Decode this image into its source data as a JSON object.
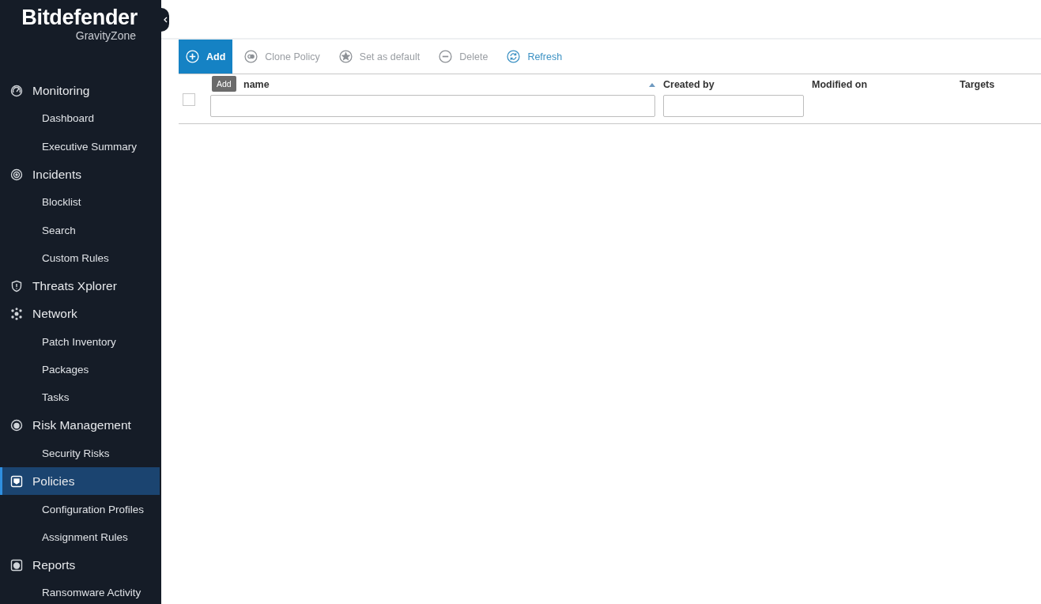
{
  "brand": {
    "name": "Bitdefender",
    "product": "GravityZone"
  },
  "nav": [
    {
      "kind": "section",
      "label": "Monitoring",
      "selected": false
    },
    {
      "kind": "sub",
      "label": "Dashboard",
      "selected": false
    },
    {
      "kind": "sub",
      "label": "Executive Summary",
      "selected": false
    },
    {
      "kind": "section",
      "label": "Incidents",
      "selected": false
    },
    {
      "kind": "sub",
      "label": "Blocklist",
      "selected": false
    },
    {
      "kind": "sub",
      "label": "Search",
      "selected": false
    },
    {
      "kind": "sub",
      "label": "Custom Rules",
      "selected": false
    },
    {
      "kind": "section",
      "label": "Threats Xplorer",
      "selected": false
    },
    {
      "kind": "section",
      "label": "Network",
      "selected": false
    },
    {
      "kind": "sub",
      "label": "Patch Inventory",
      "selected": false
    },
    {
      "kind": "sub",
      "label": "Packages",
      "selected": false
    },
    {
      "kind": "sub",
      "label": "Tasks",
      "selected": false
    },
    {
      "kind": "section",
      "label": "Risk Management",
      "selected": false
    },
    {
      "kind": "sub",
      "label": "Security Risks",
      "selected": false
    },
    {
      "kind": "section",
      "label": "Policies",
      "selected": true
    },
    {
      "kind": "sub",
      "label": "Configuration Profiles",
      "selected": false
    },
    {
      "kind": "sub",
      "label": "Assignment Rules",
      "selected": false
    },
    {
      "kind": "section",
      "label": "Reports",
      "selected": false
    },
    {
      "kind": "sub",
      "label": "Ransomware Activity",
      "selected": false
    }
  ],
  "toolbar": [
    {
      "label": "Add",
      "selected": true,
      "disabled": false
    },
    {
      "label": "Clone Policy",
      "selected": false,
      "disabled": true
    },
    {
      "label": "Set as default",
      "selected": false,
      "disabled": true
    },
    {
      "label": "Delete",
      "selected": false,
      "disabled": true
    },
    {
      "label": "Refresh",
      "selected": false,
      "disabled": false
    }
  ],
  "tooltip": "Add",
  "table": {
    "select_all": {
      "checked": false
    },
    "columns": [
      {
        "label": "name",
        "sorted": true,
        "filter": true
      },
      {
        "label": "Created by",
        "sorted": false,
        "filter": true
      },
      {
        "label": "Modified on",
        "sorted": false,
        "filter": false
      },
      {
        "label": "Targets",
        "sorted": false,
        "filter": false
      }
    ]
  }
}
